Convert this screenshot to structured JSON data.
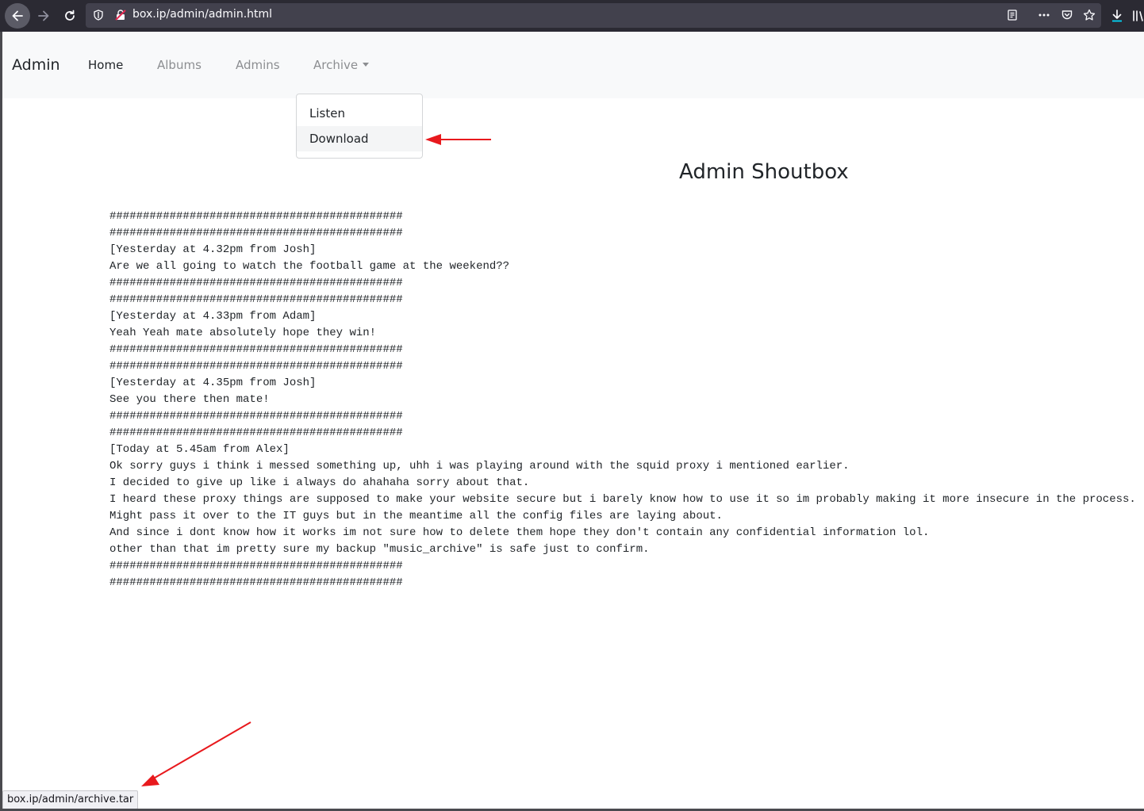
{
  "browser": {
    "url": "box.ip/admin/admin.html"
  },
  "navbar": {
    "brand": "Admin",
    "links": [
      "Home",
      "Albums",
      "Admins",
      "Archive"
    ]
  },
  "dropdown": {
    "items": [
      "Listen",
      "Download"
    ],
    "highlighted": "Download"
  },
  "page": {
    "heading": "Admin Shoutbox",
    "shoutbox_lines": [
      "############################################",
      "############################################",
      "[Yesterday at 4.32pm from Josh]",
      "Are we all going to watch the football game at the weekend??",
      "############################################",
      "############################################",
      "[Yesterday at 4.33pm from Adam]",
      "Yeah Yeah mate absolutely hope they win!",
      "############################################",
      "############################################",
      "[Yesterday at 4.35pm from Josh]",
      "See you there then mate!",
      "############################################",
      "############################################",
      "[Today at 5.45am from Alex]",
      "Ok sorry guys i think i messed something up, uhh i was playing around with the squid proxy i mentioned earlier.",
      "I decided to give up like i always do ahahaha sorry about that.",
      "I heard these proxy things are supposed to make your website secure but i barely know how to use it so im probably making it more insecure in the process.",
      "Might pass it over to the IT guys but in the meantime all the config files are laying about.",
      "And since i dont know how it works im not sure how to delete them hope they don't contain any confidential information lol.",
      "other than that im pretty sure my backup \"music_archive\" is safe just to confirm.",
      "############################################",
      "############################################"
    ]
  },
  "statusbar": {
    "link_url": "box.ip/admin/archive.tar"
  },
  "colors": {
    "annotation_arrow": "#e8191d",
    "toolbar_bg": "#2b2a33",
    "navbar_bg": "#f8f9fa"
  }
}
